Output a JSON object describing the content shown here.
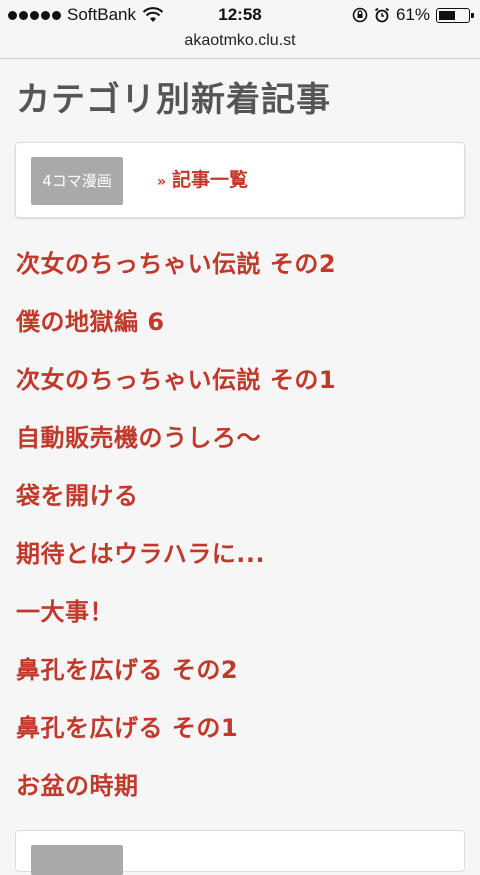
{
  "status_bar": {
    "carrier": "SoftBank",
    "time": "12:58",
    "battery_percent": "61%",
    "battery_level": 0.61,
    "icons": [
      "signal-dots-icon",
      "wifi-icon",
      "orientation-lock-icon",
      "alarm-icon",
      "battery-icon"
    ]
  },
  "browser": {
    "url": "akaotmko.clu.st"
  },
  "page": {
    "title": "カテゴリ別新着記事"
  },
  "category": {
    "tag": "4コマ漫画",
    "link_prefix": "»",
    "link_label": "記事一覧"
  },
  "articles": [
    "次女のちっちゃい伝説 その2",
    "僕の地獄編 6",
    "次女のちっちゃい伝説 その1",
    "自動販売機のうしろ〜",
    "袋を開ける",
    "期待とはウラハラに...",
    "一大事！",
    "鼻孔を広げる その2",
    "鼻孔を広げる その1",
    "お盆の時期"
  ],
  "colors": {
    "link": "#c0392b",
    "heading": "#555555",
    "tag_bg": "#a9a9a9",
    "page_bg": "#f6f6f6"
  }
}
